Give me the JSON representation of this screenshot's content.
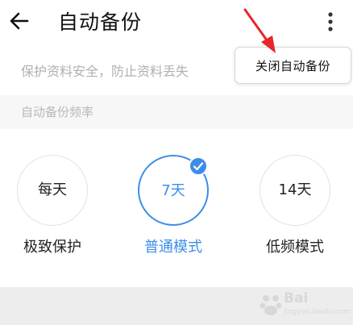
{
  "header": {
    "title": "自动备份",
    "back_icon": "arrow-left-icon",
    "more_icon": "more-vertical-icon"
  },
  "description": "保护资料安全，防止资料丢失",
  "popup": {
    "label": "关闭自动备份"
  },
  "section": {
    "title": "自动备份频率"
  },
  "options": [
    {
      "circle_text": "每天",
      "label": "极致保护",
      "selected": false
    },
    {
      "circle_text": "7天",
      "label": "普通模式",
      "selected": true
    },
    {
      "circle_text": "14天",
      "label": "低频模式",
      "selected": false
    }
  ],
  "watermark": {
    "text": "Bai",
    "sub": "jingyan.baidu.com"
  },
  "colors": {
    "accent": "#3d8de8",
    "annotation_arrow": "#e8262a",
    "muted_text": "#b0b0b0"
  }
}
